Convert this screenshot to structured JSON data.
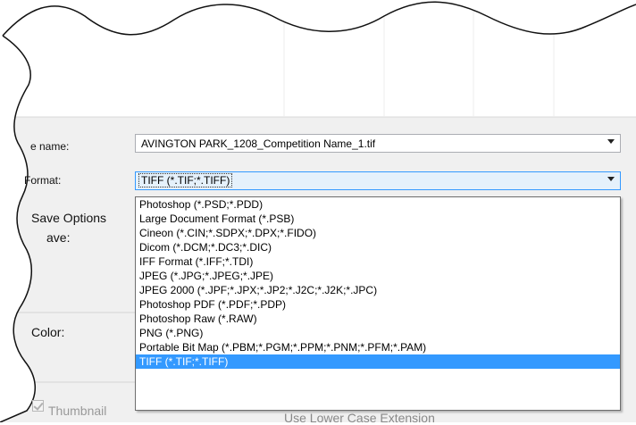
{
  "dialog": {
    "file_name_label": "e name:",
    "file_name_value": "AVINGTON PARK_1208_Competition Name_1.tif",
    "format_label": "Format:",
    "format_value": "TIFF (*.TIF;*.TIFF)",
    "save_options_label": "Save Options",
    "save_label": "ave:",
    "color_label": "Color:",
    "thumbnail_label": "Thumbnail",
    "lower_case_label": "Use Lower Case Extension"
  },
  "format_options": [
    "Photoshop (*.PSD;*.PDD)",
    "Large Document Format (*.PSB)",
    "Cineon (*.CIN;*.SDPX;*.DPX;*.FIDO)",
    "Dicom (*.DCM;*.DC3;*.DIC)",
    "IFF Format (*.IFF;*.TDI)",
    "JPEG (*.JPG;*.JPEG;*.JPE)",
    "JPEG 2000 (*.JPF;*.JPX;*.JP2;*.J2C;*.J2K;*.JPC)",
    "Photoshop PDF (*.PDF;*.PDP)",
    "Photoshop Raw (*.RAW)",
    "PNG (*.PNG)",
    "Portable Bit Map (*.PBM;*.PGM;*.PPM;*.PNM;*.PFM;*.PAM)",
    "TIFF (*.TIF;*.TIFF)"
  ],
  "selected_index": 11,
  "colors": {
    "accent": "#3399ff",
    "panel": "#f0f0f0"
  }
}
